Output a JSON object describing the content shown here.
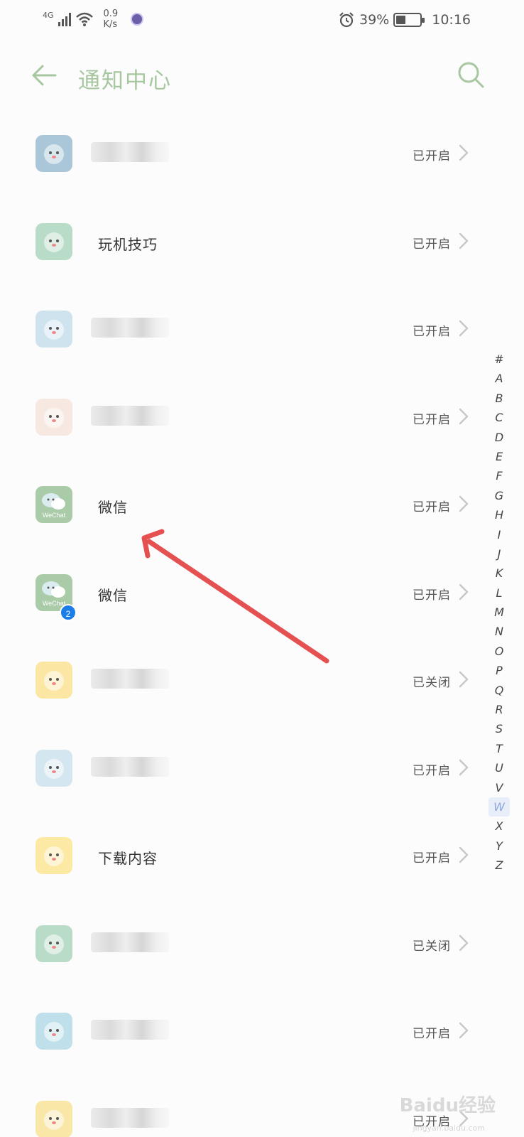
{
  "status_bar": {
    "network": "4G",
    "speed_value": "0.9",
    "speed_unit": "K/s",
    "battery_percent": "39%",
    "battery_level": 0.39,
    "time": "10:16"
  },
  "header": {
    "title": "通知中心"
  },
  "apps": [
    {
      "name": "",
      "status": "已开启",
      "icon_bg": "#a9c7d9"
    },
    {
      "name": "玩机技巧",
      "status": "已开启",
      "icon_bg": "#b8dcc8"
    },
    {
      "name": "",
      "status": "已开启",
      "icon_bg": "#cfe3ef"
    },
    {
      "name": "",
      "status": "已开启",
      "icon_bg": "#f7e9e2"
    },
    {
      "name": "微信",
      "status": "已开启",
      "icon_bg": "#a9cba8",
      "icon_text": "WeChat"
    },
    {
      "name": "微信",
      "status": "已开启",
      "icon_bg": "#a9cba8",
      "icon_text": "WeChat",
      "badge": "2"
    },
    {
      "name": "",
      "status": "已关闭",
      "icon_bg": "#fbe7a3"
    },
    {
      "name": "",
      "status": "已开启",
      "icon_bg": "#d4e6ef"
    },
    {
      "name": "下载内容",
      "status": "已开启",
      "icon_bg": "#fbe9a4"
    },
    {
      "name": "",
      "status": "已关闭",
      "icon_bg": "#b8dcc8"
    },
    {
      "name": "",
      "status": "已开启",
      "icon_bg": "#bfe0ea"
    },
    {
      "name": "",
      "status": "已开启",
      "icon_bg": "#f9e7a8"
    }
  ],
  "index_letters": [
    "#",
    "A",
    "B",
    "C",
    "D",
    "E",
    "F",
    "G",
    "H",
    "I",
    "J",
    "K",
    "L",
    "M",
    "N",
    "O",
    "P",
    "Q",
    "R",
    "S",
    "T",
    "U",
    "V",
    "W",
    "X",
    "Y",
    "Z"
  ],
  "index_active": "W",
  "watermark": {
    "brand": "Baidu经验",
    "url": "jingyan.baidu.com"
  },
  "colors": {
    "title_green": "#a7c7a0",
    "arrow_red": "#e55050",
    "background": "#fcfcfc"
  }
}
